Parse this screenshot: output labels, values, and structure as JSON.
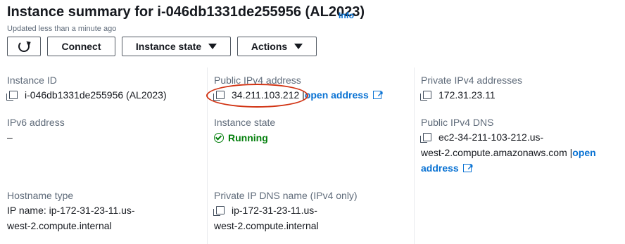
{
  "header": {
    "title": "Instance summary for i-046db1331de255956 (AL2023)",
    "info_link": "Info",
    "updated": "Updated less than a minute ago"
  },
  "toolbar": {
    "connect": "Connect",
    "instance_state": "Instance state",
    "actions": "Actions"
  },
  "details": {
    "instance_id": {
      "label": "Instance ID",
      "value": "i-046db1331de255956 (AL2023)"
    },
    "ipv6": {
      "label": "IPv6 address",
      "value": "–"
    },
    "hostname_type": {
      "label": "Hostname type",
      "value_line1": "IP name: ip-172-31-23-11.us-",
      "value_line2": "west-2.compute.internal"
    },
    "public_ipv4": {
      "label": "Public IPv4 address",
      "value": "34.211.103.212",
      "link_pipe": "|",
      "link": "open address"
    },
    "instance_state": {
      "label": "Instance state",
      "value": "Running"
    },
    "private_dns": {
      "label": "Private IP DNS name (IPv4 only)",
      "value_line1": "ip-172-31-23-11.us-",
      "value_line2": "west-2.compute.internal"
    },
    "private_ipv4": {
      "label": "Private IPv4 addresses",
      "value": "172.31.23.11"
    },
    "public_dns": {
      "label": "Public IPv4 DNS",
      "value_line1": "ec2-34-211-103-212.us-",
      "value_line2": "west-2.compute.amazonaws.com",
      "link_pipe": "|",
      "link_line1": "open",
      "link_line2": "address"
    }
  },
  "colors": {
    "link": "#0972d3",
    "running": "#037f0c",
    "annotation": "#d13212"
  },
  "icons": [
    "refresh-icon",
    "caret-down-icon",
    "copy-icon",
    "external-link-icon",
    "status-check-icon"
  ]
}
